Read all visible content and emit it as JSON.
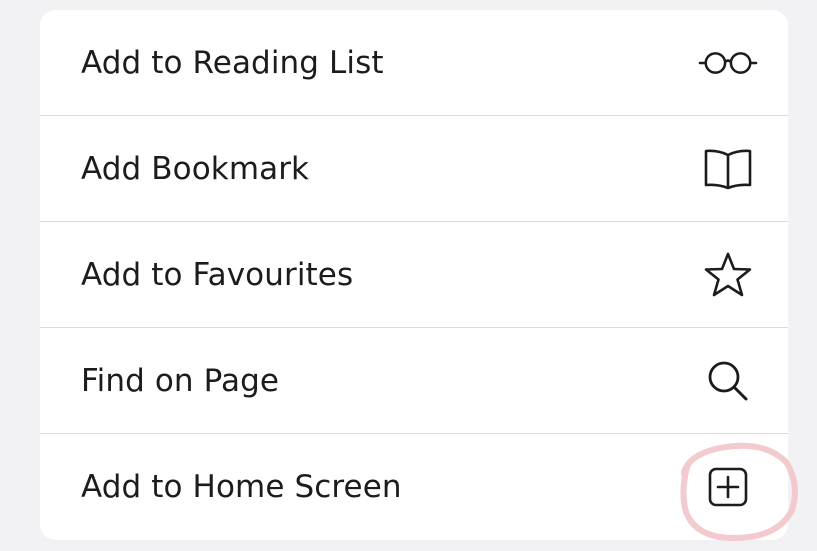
{
  "menu": {
    "items": [
      {
        "label": "Add to Reading List",
        "icon": "glasses-icon"
      },
      {
        "label": "Add Bookmark",
        "icon": "book-icon"
      },
      {
        "label": "Add to Favourites",
        "icon": "star-icon"
      },
      {
        "label": "Find on Page",
        "icon": "search-icon"
      },
      {
        "label": "Add to Home Screen",
        "icon": "add-square-icon"
      }
    ]
  },
  "colors": {
    "background": "#f2f2f4",
    "sheet": "#ffffff",
    "text": "#1c1c1e",
    "divider": "#dcdcdf",
    "highlight": "#f2c4c8"
  }
}
